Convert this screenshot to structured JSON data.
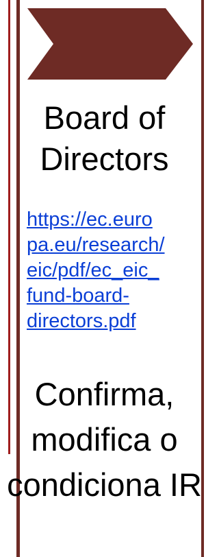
{
  "box": {
    "title": "Board of Directors",
    "link": "https://ec.europa.eu/research/eic/pdf/ec_eic_fund-board-directors.pdf",
    "link_lines": [
      "https://ec.euro",
      "pa.eu/research/",
      "eic/pdf/ec_eic_",
      "fund-board-",
      "directors.pdf"
    ],
    "description": "Confirma, modifica o condiciona IR"
  },
  "colors": {
    "accent": "#6e2b25",
    "left_rule": "#a01e1e",
    "link": "#0b3fd6"
  },
  "icons": {
    "header": "chevron-arrow-icon"
  }
}
